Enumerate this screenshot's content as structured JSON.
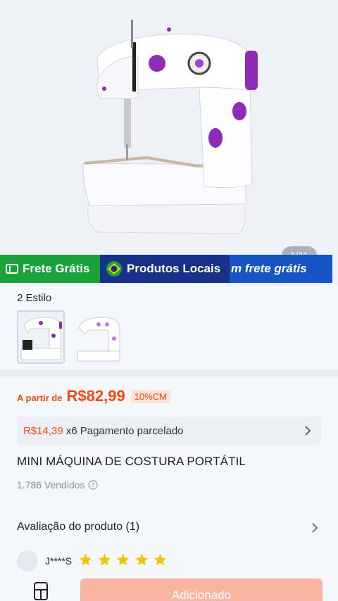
{
  "gallery": {
    "page_counter": "1/11",
    "product_image": "sewing-machine-white-purple"
  },
  "promo_banner": {
    "free_shipping": "Frete Grátis",
    "local_products": "Produtos Locais",
    "overflow_text": "m frete grátis",
    "colors": {
      "green": "#1aa33a",
      "navy": "#17308a",
      "blue": "#1656c4"
    }
  },
  "styles": {
    "title": "2 Estilo",
    "options": [
      {
        "name": "style-option-1",
        "selected": true
      },
      {
        "name": "style-option-2",
        "selected": false
      }
    ]
  },
  "price": {
    "prefix": "A partir de",
    "value": "R$82,99",
    "cashback": "10%CM",
    "accent_color": "#f04a12"
  },
  "installment": {
    "amount": "R$14,39",
    "text": "x6 Pagamento parcelado"
  },
  "product": {
    "title": "MINI MÁQUINA DE COSTURA PORTÁTIL",
    "sold": "1.786 Vendidos"
  },
  "reviews": {
    "title": "Avaliação do produto (1)",
    "reviewer": "J****S",
    "rating": 5
  },
  "bottom_bar": {
    "add_label": "Adicionado"
  }
}
